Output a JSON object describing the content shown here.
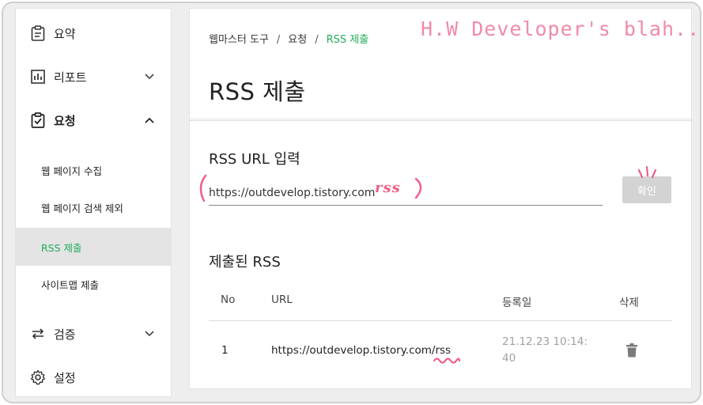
{
  "sidebar": {
    "items": [
      {
        "label": "요약",
        "icon": "clipboard-icon"
      },
      {
        "label": "리포트",
        "icon": "bar-chart-icon",
        "chevron": "chevron-down-icon"
      },
      {
        "label": "요청",
        "icon": "clipboard-check-icon",
        "chevron": "chevron-up-icon"
      },
      {
        "label": "검증",
        "icon": "swap-arrows-icon",
        "chevron": "chevron-down-icon"
      },
      {
        "label": "설정",
        "icon": "gear-icon"
      }
    ],
    "sub_items": [
      {
        "label": "웹 페이지 수집",
        "active": false
      },
      {
        "label": "웹 페이지 검색 제외",
        "active": false
      },
      {
        "label": "RSS 제출",
        "active": true
      },
      {
        "label": "사이트맵 제출",
        "active": false
      }
    ]
  },
  "breadcrumb": [
    "웹마스터 도구",
    "요청",
    "RSS 제출"
  ],
  "breadcrumb_separator": "/",
  "page_title": "RSS 제출",
  "rss_input": {
    "section_title": "RSS URL 입력",
    "value": "https://outdevelop.tistory.com",
    "confirm_label": "확인"
  },
  "submitted": {
    "section_title": "제출된 RSS",
    "columns": [
      "No",
      "URL",
      "등록일",
      "삭제"
    ],
    "rows": [
      {
        "no": "1",
        "url": "https://outdevelop.tistory.com/rss",
        "date_line1": "21.12.23 10:14:",
        "date_line2": "40"
      }
    ]
  },
  "annotations": {
    "watermark": "H.W Developer's blah..",
    "handwritten_suffix": "rss"
  },
  "colors": {
    "accent_green": "#1fae5b",
    "annotation_pink": "#f28aa8",
    "button_gray": "#d3d3d3"
  }
}
